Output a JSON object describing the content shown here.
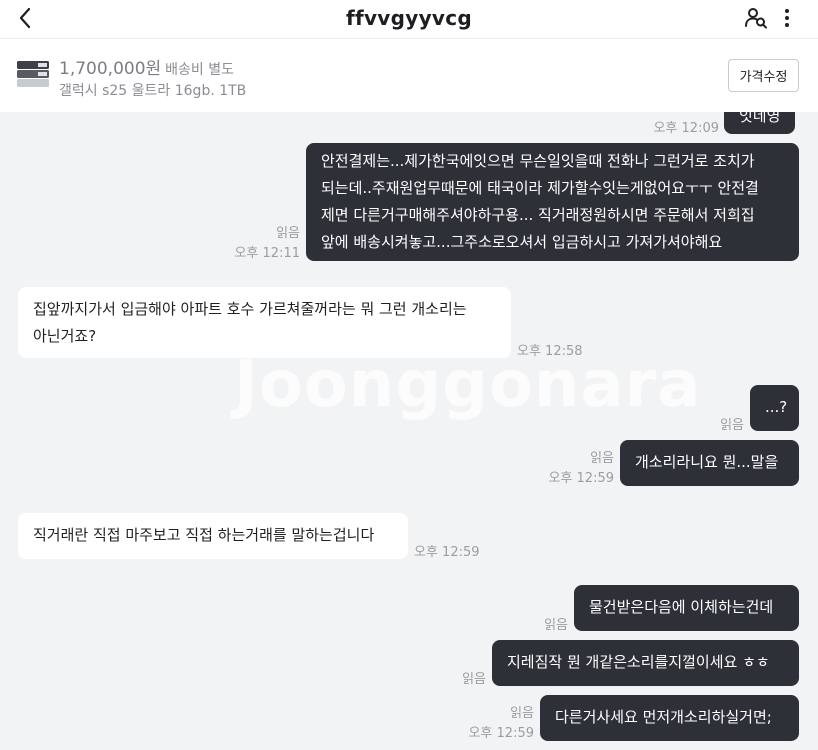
{
  "header": {
    "title": "ffvvgyyvcg"
  },
  "product": {
    "price": "1,700,000원",
    "shipping": "배송비 별도",
    "name": "갤럭시 s25 울트라 16gb. 1TB",
    "edit_button": "가격수정"
  },
  "watermark": "Joonggonara",
  "messages": [
    {
      "sender": "me",
      "text": "잇네영",
      "time": "오후 12:09"
    },
    {
      "sender": "me",
      "lines": [
        "안전결제는...제가한국에잇으면 무슨일잇을때 전화나 그런거로 조치가",
        "되는데..주재원업무때문에 태국이라 제가할수잇는게없어요ㅜㅜ 안전결",
        "제면 다른거구매해주셔야하구용... 직거래정원하시면 주문해서 저희집",
        "앞에 배송시켜놓고...그주소로오셔서 입금하시고 가져가셔야해요"
      ],
      "read": "읽음",
      "time": "오후 12:11"
    },
    {
      "sender": "them",
      "lines": [
        "집앞까지가서 입금해야 아파트 호수 가르쳐줄꺼라는 뭐 그런 개소리는",
        "아닌거죠?"
      ],
      "time": "오후 12:58"
    },
    {
      "sender": "me",
      "text": "...?",
      "read": "읽음"
    },
    {
      "sender": "me",
      "text": "개소리라니요 뭔...말을",
      "read": "읽음",
      "time": "오후 12:59"
    },
    {
      "sender": "them",
      "text": "직거래란 직접 마주보고 직접 하는거래를 말하는겁니다",
      "time": "오후 12:59"
    },
    {
      "sender": "me",
      "text": "물건받은다음에 이체하는건데",
      "read": "읽음"
    },
    {
      "sender": "me",
      "text": "지레짐작 뭔 개같은소리를지껄이세요 ㅎㅎ",
      "read": "읽음"
    },
    {
      "sender": "me",
      "text": "다른거사세요 먼저개소리하실거면;",
      "read": "읽음",
      "time": "오후 12:59"
    }
  ]
}
